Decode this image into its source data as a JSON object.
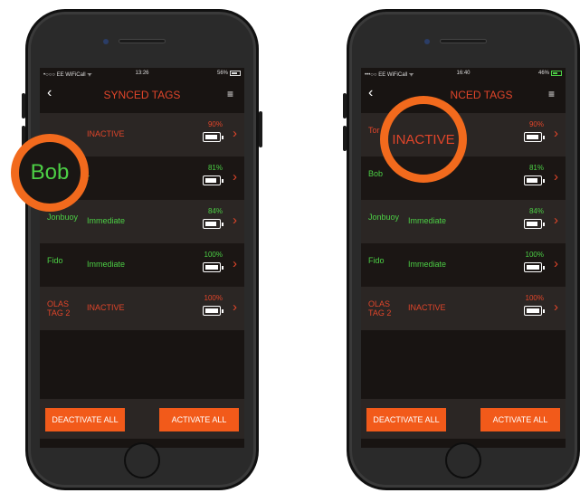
{
  "left_phone": {
    "status": {
      "carrier": "•○○○ EE WiFiCall ᯤ",
      "time": "13:26",
      "battery": "56%"
    },
    "nav": {
      "back": "‹",
      "title": "SYNCED TAGS",
      "menu": "≡"
    },
    "tags": [
      {
        "name": "",
        "status": "INACTIVE",
        "percent": "90%",
        "level": 0.9,
        "name_color": "red",
        "status_color": "red"
      },
      {
        "name": "",
        "status": "r",
        "percent": "81%",
        "level": 0.81,
        "name_color": "green",
        "status_color": "green"
      },
      {
        "name": "Jonbuoy",
        "status": "Immediate",
        "percent": "84%",
        "level": 0.84,
        "name_color": "green",
        "status_color": "green"
      },
      {
        "name": "Fido",
        "status": "Immediate",
        "percent": "100%",
        "level": 1.0,
        "name_color": "green",
        "status_color": "green"
      },
      {
        "name": "OLAS TAG 2",
        "status": "INACTIVE",
        "percent": "100%",
        "level": 1.0,
        "name_color": "red",
        "status_color": "red"
      }
    ],
    "buttons": {
      "deactivate": "DEACTIVATE ALL",
      "activate": "ACTIVATE ALL"
    },
    "highlight": "Bob"
  },
  "right_phone": {
    "status": {
      "carrier": "•••○○ EE WiFiCall ᯤ",
      "time": "16:40",
      "battery": "46%"
    },
    "nav": {
      "back": "‹",
      "title": "NCED TAGS",
      "menu": "≡"
    },
    "tags": [
      {
        "name": "Tor",
        "status": "",
        "percent": "90%",
        "level": 0.9,
        "name_color": "red",
        "status_color": "red"
      },
      {
        "name": "Bob",
        "status": "",
        "percent": "81%",
        "level": 0.81,
        "name_color": "green",
        "status_color": "green"
      },
      {
        "name": "Jonbuoy",
        "status": "Immediate",
        "percent": "84%",
        "level": 0.84,
        "name_color": "green",
        "status_color": "green"
      },
      {
        "name": "Fido",
        "status": "Immediate",
        "percent": "100%",
        "level": 1.0,
        "name_color": "green",
        "status_color": "green"
      },
      {
        "name": "OLAS TAG 2",
        "status": "INACTIVE",
        "percent": "100%",
        "level": 1.0,
        "name_color": "red",
        "status_color": "red"
      }
    ],
    "buttons": {
      "deactivate": "DEACTIVATE ALL",
      "activate": "ACTIVATE ALL"
    },
    "highlight": "INACTIVE"
  },
  "colors": {
    "accent": "#f25a1a",
    "active_green": "#4ccf45",
    "inactive_red": "#e0452a"
  }
}
